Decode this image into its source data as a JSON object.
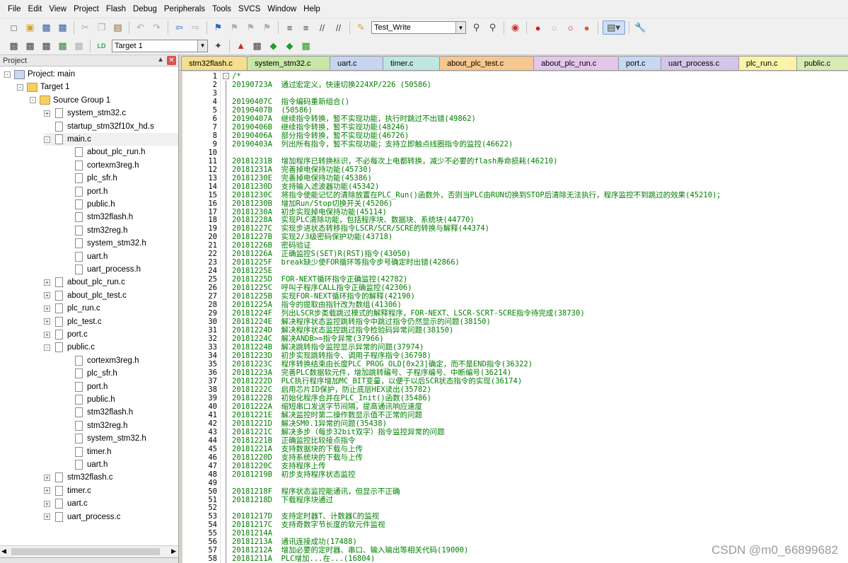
{
  "menu": [
    "File",
    "Edit",
    "View",
    "Project",
    "Flash",
    "Debug",
    "Peripherals",
    "Tools",
    "SVCS",
    "Window",
    "Help"
  ],
  "toolbar": {
    "find_combo_value": "Test_Write",
    "target_combo_value": "Target 1"
  },
  "project_panel": {
    "title": "Project",
    "tree": [
      {
        "label": "Project: main",
        "level": 0,
        "icon": "project-icon",
        "expander": "-"
      },
      {
        "label": "Target 1",
        "level": 1,
        "icon": "folder-icon",
        "expander": "-"
      },
      {
        "label": "Source Group 1",
        "level": 2,
        "icon": "folder-icon",
        "expander": "-"
      },
      {
        "label": "system_stm32.c",
        "level": 3,
        "icon": "file-icon",
        "expander": "+"
      },
      {
        "label": "startup_stm32f10x_hd.s",
        "level": 3,
        "icon": "file-icon",
        "expander": ""
      },
      {
        "label": "main.c",
        "level": 3,
        "icon": "file-icon",
        "expander": "-"
      },
      {
        "label": "about_plc_run.h",
        "level": 4,
        "icon": "file-icon",
        "expander": ""
      },
      {
        "label": "cortexm3reg.h",
        "level": 4,
        "icon": "file-icon",
        "expander": ""
      },
      {
        "label": "plc_sfr.h",
        "level": 4,
        "icon": "file-icon",
        "expander": ""
      },
      {
        "label": "port.h",
        "level": 4,
        "icon": "file-icon",
        "expander": ""
      },
      {
        "label": "public.h",
        "level": 4,
        "icon": "file-icon",
        "expander": ""
      },
      {
        "label": "stm32flash.h",
        "level": 4,
        "icon": "file-icon",
        "expander": ""
      },
      {
        "label": "stm32reg.h",
        "level": 4,
        "icon": "file-icon",
        "expander": ""
      },
      {
        "label": "system_stm32.h",
        "level": 4,
        "icon": "file-icon",
        "expander": ""
      },
      {
        "label": "uart.h",
        "level": 4,
        "icon": "file-icon",
        "expander": ""
      },
      {
        "label": "uart_process.h",
        "level": 4,
        "icon": "file-icon",
        "expander": ""
      },
      {
        "label": "about_plc_run.c",
        "level": 3,
        "icon": "file-icon",
        "expander": "+"
      },
      {
        "label": "about_plc_test.c",
        "level": 3,
        "icon": "file-icon",
        "expander": "+"
      },
      {
        "label": "plc_run.c",
        "level": 3,
        "icon": "file-icon",
        "expander": "+"
      },
      {
        "label": "plc_test.c",
        "level": 3,
        "icon": "file-icon",
        "expander": "+"
      },
      {
        "label": "port.c",
        "level": 3,
        "icon": "file-icon",
        "expander": "+"
      },
      {
        "label": "public.c",
        "level": 3,
        "icon": "file-icon",
        "expander": "-"
      },
      {
        "label": "cortexm3reg.h",
        "level": 4,
        "icon": "file-icon",
        "expander": ""
      },
      {
        "label": "plc_sfr.h",
        "level": 4,
        "icon": "file-icon",
        "expander": ""
      },
      {
        "label": "port.h",
        "level": 4,
        "icon": "file-icon",
        "expander": ""
      },
      {
        "label": "public.h",
        "level": 4,
        "icon": "file-icon",
        "expander": ""
      },
      {
        "label": "stm32flash.h",
        "level": 4,
        "icon": "file-icon",
        "expander": ""
      },
      {
        "label": "stm32reg.h",
        "level": 4,
        "icon": "file-icon",
        "expander": ""
      },
      {
        "label": "system_stm32.h",
        "level": 4,
        "icon": "file-icon",
        "expander": ""
      },
      {
        "label": "timer.h",
        "level": 4,
        "icon": "file-icon",
        "expander": ""
      },
      {
        "label": "uart.h",
        "level": 4,
        "icon": "file-icon",
        "expander": ""
      },
      {
        "label": "stm32flash.c",
        "level": 3,
        "icon": "file-icon",
        "expander": "+"
      },
      {
        "label": "timer.c",
        "level": 3,
        "icon": "file-icon",
        "expander": "+"
      },
      {
        "label": "uart.c",
        "level": 3,
        "icon": "file-icon",
        "expander": "+"
      },
      {
        "label": "uart_process.c",
        "level": 3,
        "icon": "file-icon",
        "expander": "+"
      }
    ]
  },
  "tabs": [
    {
      "label": "stm32flash.c",
      "color": "#f3df8f"
    },
    {
      "label": "system_stm32.c",
      "color": "#c8e6a8"
    },
    {
      "label": "uart.c",
      "color": "#c6d6f0"
    },
    {
      "label": "timer.c",
      "color": "#bfe6e0"
    },
    {
      "label": "about_plc_test.c",
      "color": "#f6c78e"
    },
    {
      "label": "about_plc_run.c",
      "color": "#e3c6ea"
    },
    {
      "label": "port.c",
      "color": "#c6d8f2"
    },
    {
      "label": "uart_process.c",
      "color": "#d4c6e8"
    },
    {
      "label": "plc_run.c",
      "color": "#fbf3a8"
    },
    {
      "label": "public.c",
      "color": "#d6ecb4"
    }
  ],
  "code_lines": [
    {
      "n": "1",
      "t": "/*"
    },
    {
      "n": "2",
      "t": "20190723A  通过宏定义，快速切换224XP/226 (50586)"
    },
    {
      "n": "3",
      "t": ""
    },
    {
      "n": "4",
      "t": "20190407C  指令编码重新组合()"
    },
    {
      "n": "5",
      "t": "20190407B  (50586)"
    },
    {
      "n": "6",
      "t": "20190407A  继续指令转换，暂不实现功能，执行时跳过不出错(49862)"
    },
    {
      "n": "7",
      "t": "20190406B  继续指令转换，暂不实现功能(48246)"
    },
    {
      "n": "8",
      "t": "20190406A  部分指令转换，暂不实现功能(46726)"
    },
    {
      "n": "9",
      "t": "20190403A  列出所有指令，暂不实现功能；支持立即触点线圈指令的监控(46622)"
    },
    {
      "n": "10",
      "t": ""
    },
    {
      "n": "11",
      "t": "20181231B  增加程序已转换标识，不必每次上电都转换，减少不必要的flash寿命损耗(46210)"
    },
    {
      "n": "12",
      "t": "20181231A  完善掉电保持功能(45730)"
    },
    {
      "n": "13",
      "t": "20181230E  完善掉电保持功能(45386)"
    },
    {
      "n": "14",
      "t": "20181230D  支持输入滤波器功能(45342)"
    },
    {
      "n": "15",
      "t": "20181230C  将指令使能记忆的清除放置在PLC_Run()函数外，否则当PLC由RUN切换到STOP后清除无法执行，程序监控不到跳过的效果(45210)；"
    },
    {
      "n": "16",
      "t": "20181230B  增加Run/Stop切换开关(45206)"
    },
    {
      "n": "17",
      "t": "20181230A  初步实现掉电保持功能(45114)"
    },
    {
      "n": "18",
      "t": "20181228A  实现PLC清除功能，包括程序块、数据块、系统块(44770)"
    },
    {
      "n": "19",
      "t": "20181227C  实现步进状态转移指令LSCR/SCR/SCRE的转换与解释(44374)"
    },
    {
      "n": "20",
      "t": "20181227B  实现2/3级密码保护功能(43718)"
    },
    {
      "n": "21",
      "t": "20181226B  密码验证"
    },
    {
      "n": "22",
      "t": "20181226A  正确监控S(SET)R(RST)指令(43050)"
    },
    {
      "n": "23",
      "t": "20181225F  break缺少使FOR循环等指令步号确定时出错(42866)"
    },
    {
      "n": "24",
      "t": "20181225E"
    },
    {
      "n": "25",
      "t": "20181225D  FOR-NEXT循环指令正确监控(42782)"
    },
    {
      "n": "26",
      "t": "20181225C  呼叫子程序CALL指令正确监控(42306)"
    },
    {
      "n": "27",
      "t": "20181225B  实现FOR-NEXT循环指令的解释(42190)"
    },
    {
      "n": "28",
      "t": "20181225A  指令的提取由指针改为数组(41306)"
    },
    {
      "n": "29",
      "t": "20181224F  列出LSCR步类载跳过模式的解释程序，FOR-NEXT、LSCR-SCRT-SCRE指令待完成(38730)"
    },
    {
      "n": "30",
      "t": "20181224E  解决程序状态监控跳转指令中跳过指令仍然显示的问题(38150)"
    },
    {
      "n": "31",
      "t": "20181224D  解决程序状态监控跳过指令检验码异常问题(38150)"
    },
    {
      "n": "32",
      "t": "20181224C  解决ANDB>=指令异常(37966)"
    },
    {
      "n": "33",
      "t": "20181224B  解决跳转指令监控显示异常的问题(37974)"
    },
    {
      "n": "34",
      "t": "20181223D  初步实现跳转指令、调用子程序指令(36798)"
    },
    {
      "n": "35",
      "t": "20181223C  程序转换结束由长度PLC_PROG_OLD[0x23]确定，而不是END指令(36322)"
    },
    {
      "n": "36",
      "t": "20181223A  完善PLC数据软元件，增加跳转编号、子程序编号、中断编号(36214)"
    },
    {
      "n": "37",
      "t": "20181222D  PLC执行程序增加MC_BIT变量，以便于以后SCR状态指令的实现(36174)"
    },
    {
      "n": "38",
      "t": "20181222C  启用芯片ID保护，防止底层HEX读出(35782)"
    },
    {
      "n": "39",
      "t": "20181222B  初始化程序合并在PLC_Init()函数(35486)"
    },
    {
      "n": "40",
      "t": "20181222A  缩短串口发送字节间隔，提高通讯响应速度"
    },
    {
      "n": "41",
      "t": "20181221E  解决监控时第二操作数显示值不正常的问题"
    },
    {
      "n": "42",
      "t": "20181221D  解决SM0.1异常的问题(35438)"
    },
    {
      "n": "43",
      "t": "20181221C  解决多步（每步32bit双字）指令监控异常的问题"
    },
    {
      "n": "44",
      "t": "20181221B  正确监控比较接点指令"
    },
    {
      "n": "45",
      "t": "20181221A  支持数据块的下载与上传"
    },
    {
      "n": "46",
      "t": "20181220D  支持系统块的下载与上传"
    },
    {
      "n": "47",
      "t": "20181220C  支持程序上传"
    },
    {
      "n": "48",
      "t": "20181219B  初步支持程序状态监控"
    },
    {
      "n": "49",
      "t": ""
    },
    {
      "n": "50",
      "t": "20181218F  程序状态监控能通讯，但显示不正确"
    },
    {
      "n": "51",
      "t": "20181218D  下载程序块通过"
    },
    {
      "n": "52",
      "t": ""
    },
    {
      "n": "53",
      "t": "20181217D  支持定时器T、计数器C的监视"
    },
    {
      "n": "54",
      "t": "20181217C  支持奇数字节长度的软元件监视"
    },
    {
      "n": "55",
      "t": "20181214A"
    },
    {
      "n": "56",
      "t": "20181213A  通讯连接成功(17488)"
    },
    {
      "n": "57",
      "t": "20181212A  增加必要的定时器、串口、输入输出等相关代码(19000)"
    },
    {
      "n": "58",
      "t": "20181211A  PLC增加...在...(16804)"
    }
  ],
  "watermark": "CSDN @m0_66899682"
}
